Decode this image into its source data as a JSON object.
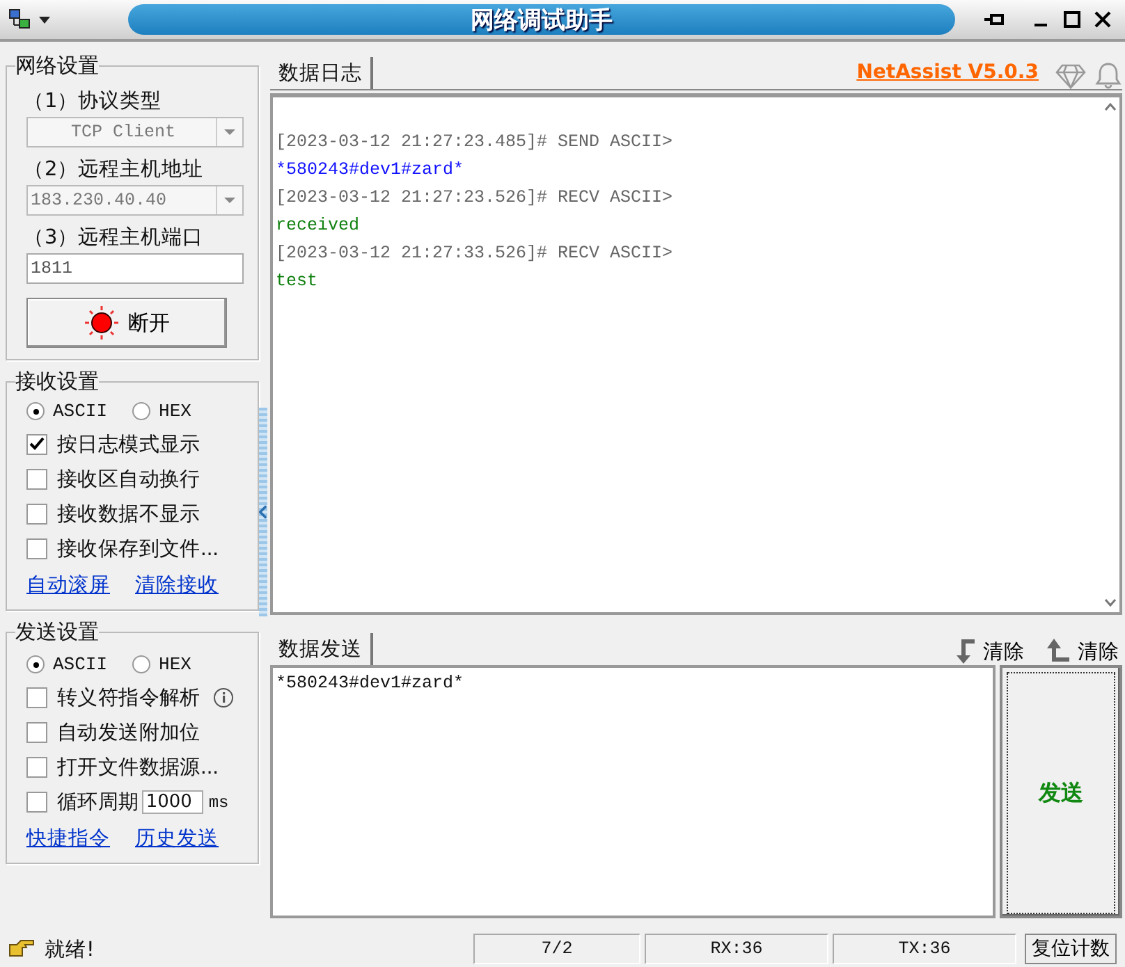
{
  "window": {
    "title": "网络调试助手"
  },
  "network_settings": {
    "title": "网络设置",
    "protocol_label": "（1）协议类型",
    "protocol": "TCP Client",
    "host_label": "（2）远程主机地址",
    "host": "183.230.40.40",
    "port_label": "（3）远程主机端口",
    "port": "1811",
    "connect_button": "断开"
  },
  "receive_settings": {
    "title": "接收设置",
    "modes": [
      {
        "label": "ASCII",
        "selected": true
      },
      {
        "label": "HEX",
        "selected": false
      }
    ],
    "options": [
      {
        "label": "按日志模式显示",
        "checked": true
      },
      {
        "label": "接收区自动换行",
        "checked": false
      },
      {
        "label": "接收数据不显示",
        "checked": false
      },
      {
        "label": "接收保存到文件...",
        "checked": false
      }
    ],
    "links": [
      "自动滚屏",
      "清除接收"
    ]
  },
  "send_settings": {
    "title": "发送设置",
    "modes": [
      {
        "label": "ASCII",
        "selected": true
      },
      {
        "label": "HEX",
        "selected": false
      }
    ],
    "options": [
      {
        "label": "转义符指令解析",
        "checked": false,
        "kind": "info"
      },
      {
        "label": "自动发送附加位",
        "checked": false,
        "kind": "plain"
      },
      {
        "label": "打开文件数据源...",
        "checked": false,
        "kind": "plain"
      },
      {
        "label": "循环周期",
        "checked": false,
        "kind": "period",
        "value": "1000",
        "unit": "ms"
      }
    ],
    "links": [
      "快捷指令",
      "历史发送"
    ]
  },
  "log": {
    "tab": "数据日志",
    "version_link": "NetAssist V5.0.3",
    "lines": [
      {
        "kind": "header",
        "text": "[2023-03-12 21:27:23.485]# SEND ASCII>"
      },
      {
        "kind": "send",
        "text": "*580243#dev1#zard*"
      },
      {
        "kind": "header",
        "text": "[2023-03-12 21:27:23.526]# RECV ASCII>"
      },
      {
        "kind": "recv",
        "text": "received"
      },
      {
        "kind": "header",
        "text": "[2023-03-12 21:27:33.526]# RECV ASCII>"
      },
      {
        "kind": "recv",
        "text": "test"
      }
    ]
  },
  "send": {
    "tab": "数据发送",
    "clear_buttons": [
      "清除",
      "清除"
    ],
    "value": "*580243#dev1#zard*",
    "send_button": "发送"
  },
  "status_bar": {
    "message": "就绪!",
    "count": "7/2",
    "rx": "RX:36",
    "tx": "TX:36",
    "reset_button": "复位计数"
  }
}
